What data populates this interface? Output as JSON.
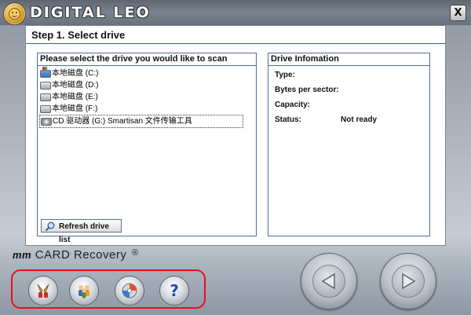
{
  "window": {
    "title": "DIGITAL LEO",
    "close_label": "X"
  },
  "step": {
    "title": "Step 1. Select drive"
  },
  "drive_panel": {
    "header": "Please select the drive you would like to scan",
    "drives": [
      {
        "label": "本地磁盘 (C:)",
        "icon": "system-drive-icon"
      },
      {
        "label": "本地磁盘 (D:)",
        "icon": "hard-drive-icon"
      },
      {
        "label": "本地磁盘 (E:)",
        "icon": "hard-drive-icon"
      },
      {
        "label": "本地磁盘 (F:)",
        "icon": "hard-drive-icon"
      },
      {
        "label": "CD 驱动器 (G:) Smartisan 文件传输工具",
        "icon": "cd-drive-icon"
      }
    ],
    "selected_index": 4,
    "refresh_label": "Refresh drive list"
  },
  "info_panel": {
    "header": "Drive Infomation",
    "fields": [
      {
        "label": "Type:",
        "value": ""
      },
      {
        "label": "Bytes per sector:",
        "value": ""
      },
      {
        "label": "Capacity:",
        "value": ""
      },
      {
        "label": "Status:",
        "value": "Not ready"
      }
    ]
  },
  "brand": {
    "prefix": "mm",
    "name": "CARD Recovery",
    "mark": "®"
  },
  "toolbar": {
    "buttons": [
      "tools-icon",
      "people-icon",
      "cd-globe-icon",
      "help-icon"
    ],
    "help_glyph": "?"
  },
  "navigation": {
    "back": "back-arrow-icon",
    "next": "next-arrow-icon"
  },
  "colors": {
    "highlight_border": "#e3121d",
    "panel_border": "#4d6f9c"
  }
}
